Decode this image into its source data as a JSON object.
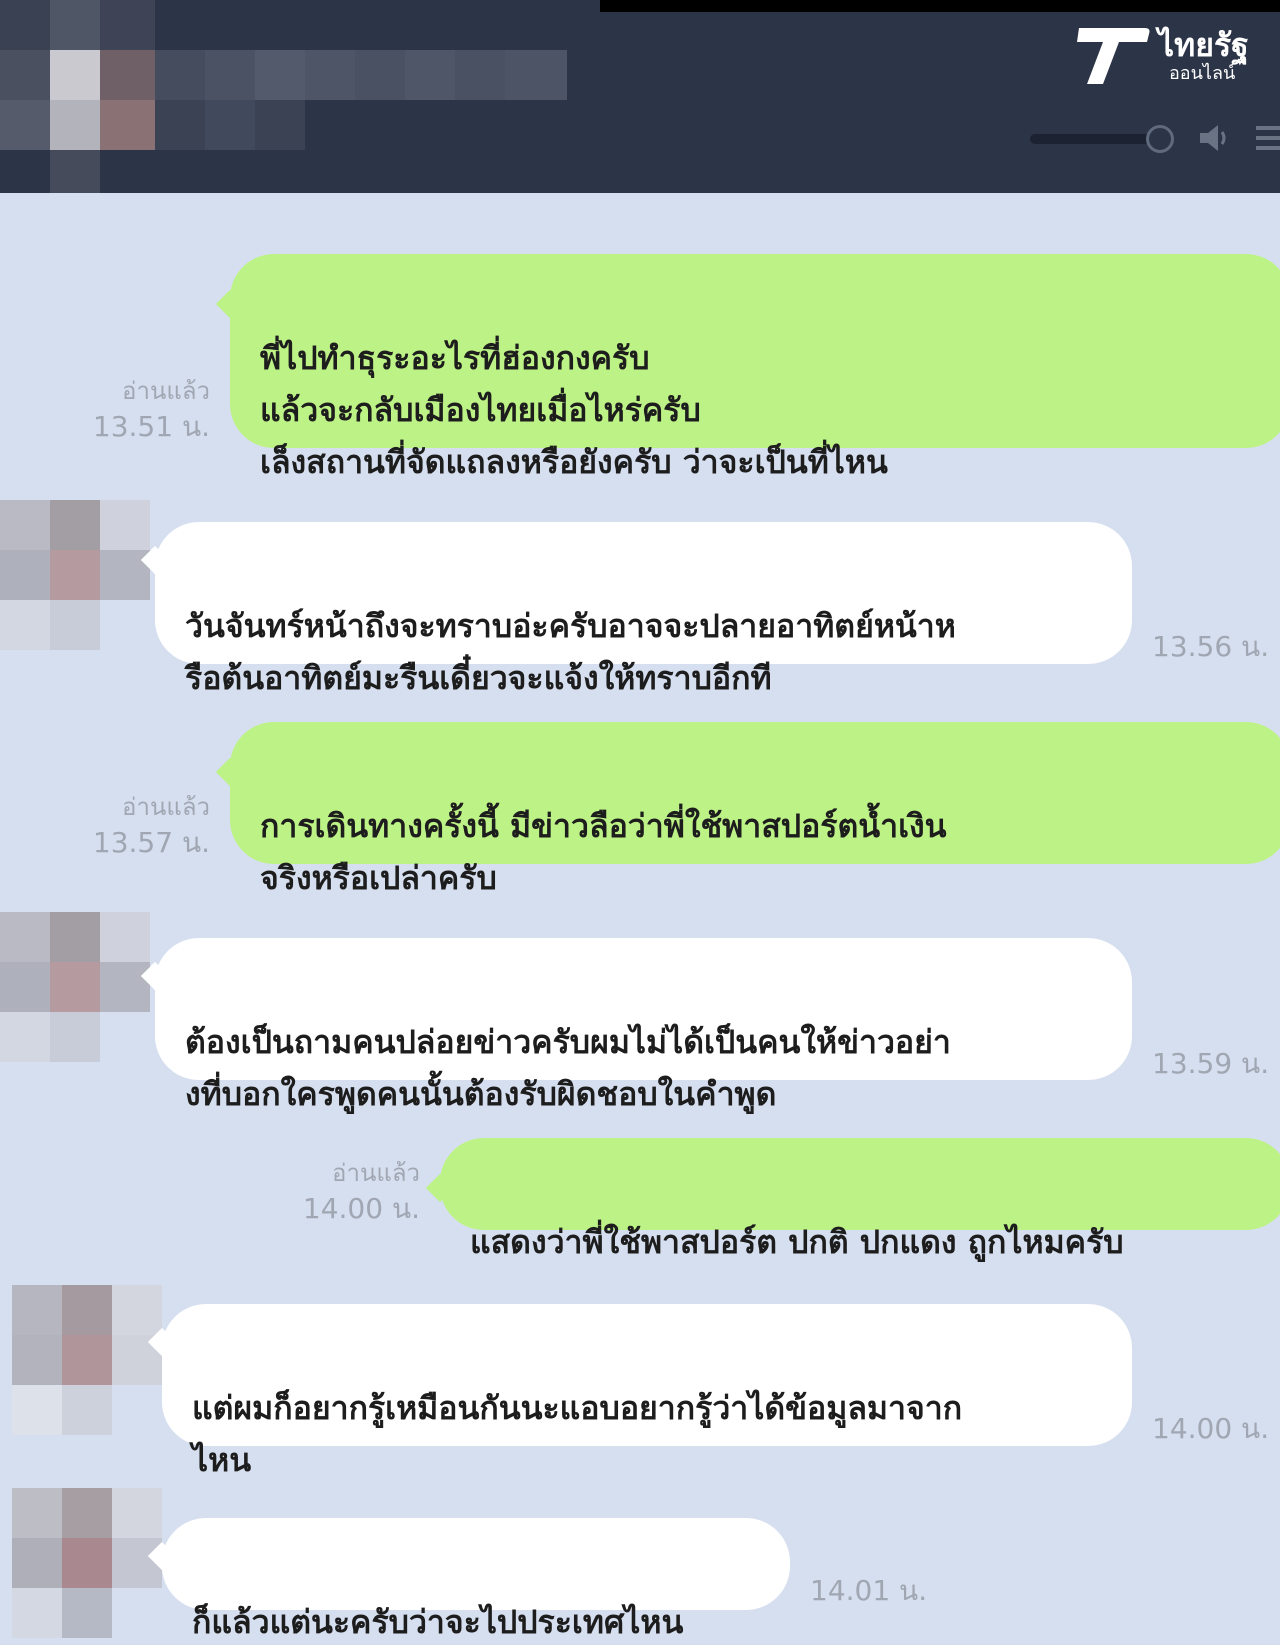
{
  "brand": {
    "name": "ไทยรัฐ",
    "sub": "ออนไลน์"
  },
  "messages": [
    {
      "dir": "out",
      "text": "พี่ไปทำธุระอะไรที่ฮ่องกงครับ\nแล้วจะกลับเมืองไทยเมื่อไหร่ครับ\nเล็งสถานที่จัดแถลงหรือยังครับ ว่าจะเป็นที่ไหน",
      "read": "อ่านแล้ว",
      "time": "13.51 น."
    },
    {
      "dir": "in",
      "text": "วันจันทร์หน้าถึงจะทราบอ่ะครับอาจจะปลายอาทิตย์หน้าห\nรือต้นอาทิตย์มะรืนเดี๋ยวจะแจ้งให้ทราบอีกที",
      "time": "13.56 น."
    },
    {
      "dir": "out",
      "text": "การเดินทางครั้งนี้ มีข่าวลือว่าพี่ใช้พาสปอร์ตน้ำเงิน\nจริงหรือเปล่าครับ",
      "read": "อ่านแล้ว",
      "time": "13.57 น."
    },
    {
      "dir": "in",
      "text": "ต้องเป็นถามคนปล่อยข่าวครับผมไม่ได้เป็นคนให้ข่าวอย่า\nงที่บอกใครพูดคนนั้นต้องรับผิดชอบในคำพูด",
      "time": "13.59 น."
    },
    {
      "dir": "out",
      "text": "แสดงว่าพี่ใช้พาสปอร์ต ปกติ ปกแดง ถูกไหมครับ",
      "read": "อ่านแล้ว",
      "time": "14.00 น."
    },
    {
      "dir": "in",
      "text": "แต่ผมก็อยากรู้เหมือนกันนะแอบอยากรู้ว่าได้ข้อมูลมาจาก\nไหน",
      "time": "14.00 น."
    },
    {
      "dir": "in",
      "text": "ก็แล้วแต่นะครับว่าจะไปประเทศไหน",
      "time": "14.01 น."
    }
  ]
}
